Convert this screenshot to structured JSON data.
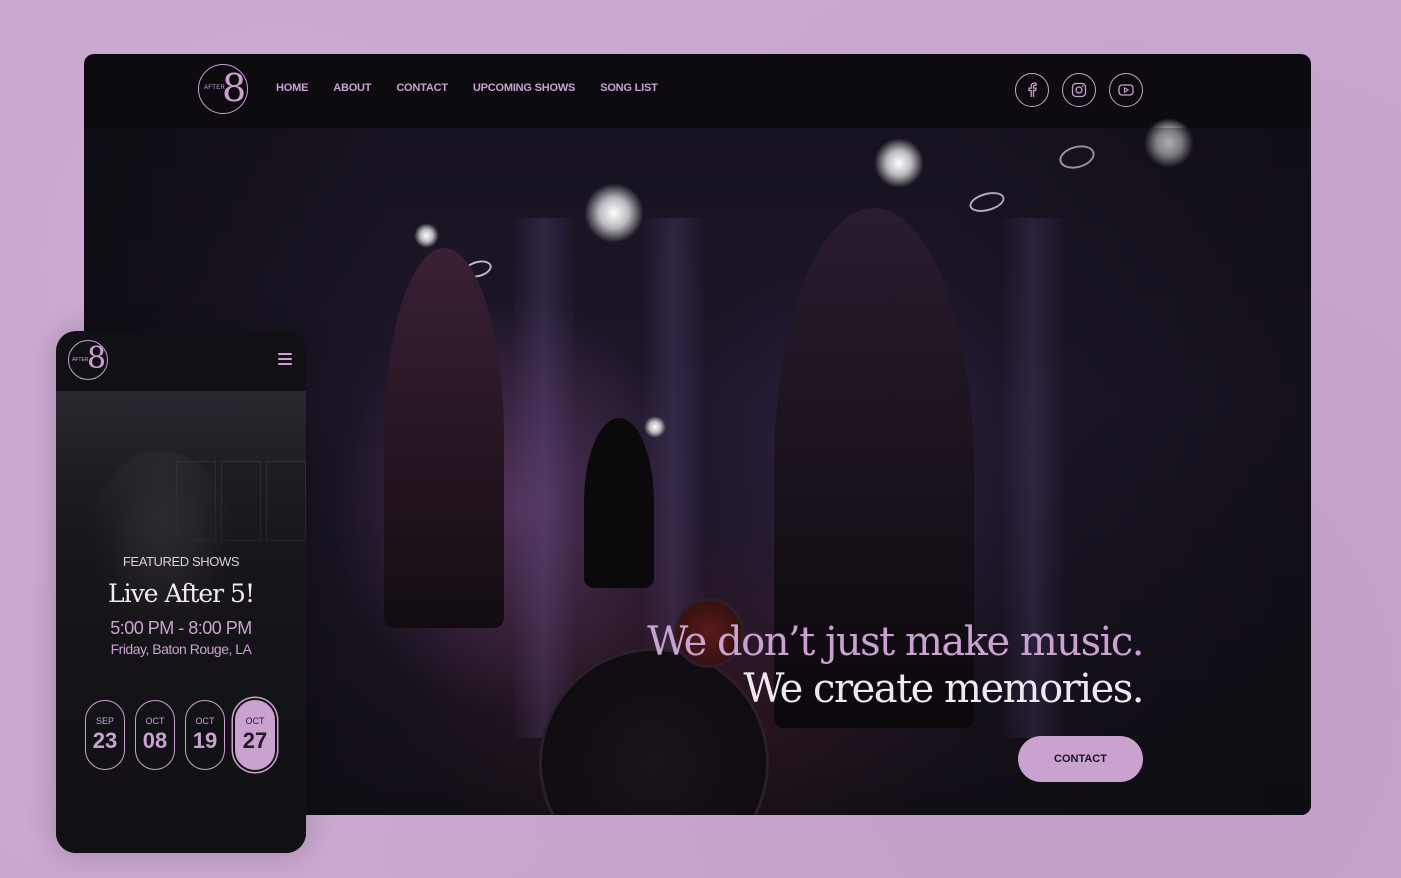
{
  "colors": {
    "accent": "#c9a2d0",
    "background": "#c9a7cf",
    "panel": "#0d0b10"
  },
  "logo": {
    "small": "AFTER",
    "big": "8"
  },
  "nav": {
    "items": [
      "HOME",
      "ABOUT",
      "CONTACT",
      "UPCOMING SHOWS",
      "SONG LIST"
    ]
  },
  "social": [
    {
      "icon": "facebook-icon"
    },
    {
      "icon": "instagram-icon"
    },
    {
      "icon": "youtube-icon"
    }
  ],
  "hero": {
    "tagline_1": "We don’t just make music.",
    "tagline_2": "We create memories.",
    "cta": "CONTACT"
  },
  "mobile": {
    "eyebrow": "FEATURED SHOWS",
    "title": "Live After 5!",
    "time": "5:00 PM - 8:00 PM",
    "place": "Friday, Baton Rouge, LA",
    "dates": [
      {
        "month": "SEP",
        "day": "23",
        "active": false
      },
      {
        "month": "OCT",
        "day": "08",
        "active": false
      },
      {
        "month": "OCT",
        "day": "19",
        "active": false
      },
      {
        "month": "OCT",
        "day": "27",
        "active": true
      }
    ]
  }
}
